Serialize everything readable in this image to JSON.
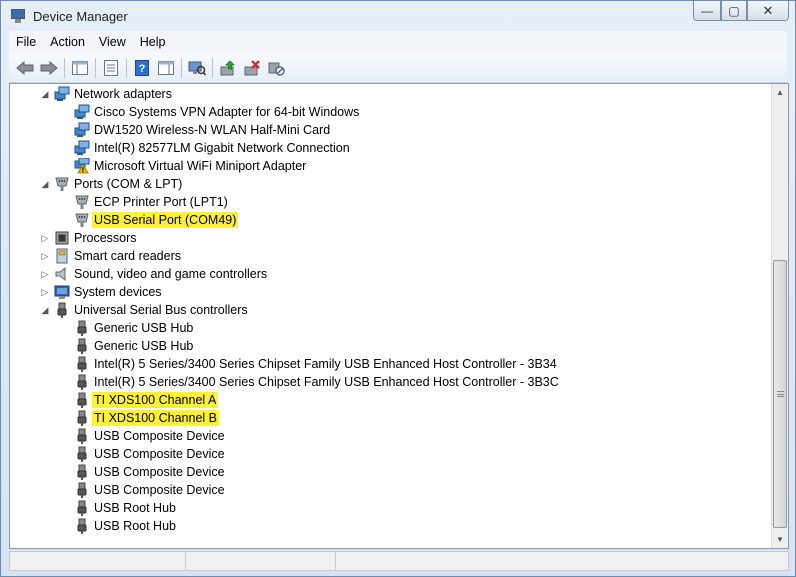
{
  "window": {
    "title": "Device Manager",
    "min_symbol": "—",
    "max_symbol": "▢",
    "close_symbol": "✕"
  },
  "menu": {
    "items": [
      "File",
      "Action",
      "View",
      "Help"
    ]
  },
  "toolbar": {
    "buttons": [
      {
        "name": "back-button",
        "glyph": "⇦"
      },
      {
        "name": "forward-button",
        "glyph": "⇨"
      },
      {
        "name": "show-hide-console-tree-button",
        "glyph": "▤"
      },
      {
        "name": "properties-button",
        "glyph": "▦"
      },
      {
        "name": "help-button",
        "glyph": "?"
      },
      {
        "name": "show-action-pane-button",
        "glyph": "▣"
      },
      {
        "name": "scan-hardware-changes-button",
        "glyph": "⌕"
      },
      {
        "name": "update-driver-button",
        "glyph": "⇪"
      },
      {
        "name": "uninstall-button",
        "glyph": "✖"
      },
      {
        "name": "disable-button",
        "glyph": "⊘"
      }
    ]
  },
  "tree": {
    "rows": [
      {
        "label": "Network adapters",
        "level": 0,
        "expanded": true,
        "icon": "network-adapter-icon",
        "highlight": false
      },
      {
        "label": "Cisco Systems VPN Adapter for 64-bit Windows",
        "level": 1,
        "icon": "network-adapter-icon",
        "highlight": false
      },
      {
        "label": "DW1520 Wireless-N WLAN Half-Mini Card",
        "level": 1,
        "icon": "network-adapter-icon",
        "highlight": false
      },
      {
        "label": "Intel(R) 82577LM Gigabit Network Connection",
        "level": 1,
        "icon": "network-adapter-icon",
        "highlight": false
      },
      {
        "label": "Microsoft Virtual WiFi Miniport Adapter",
        "level": 1,
        "icon": "network-adapter-warning-icon",
        "highlight": false
      },
      {
        "label": "Ports (COM & LPT)",
        "level": 0,
        "expanded": true,
        "icon": "port-icon",
        "highlight": false
      },
      {
        "label": "ECP Printer Port (LPT1)",
        "level": 1,
        "icon": "port-icon",
        "highlight": false
      },
      {
        "label": "USB Serial Port (COM49)",
        "level": 1,
        "icon": "port-icon",
        "highlight": true
      },
      {
        "label": "Processors",
        "level": 0,
        "expanded": false,
        "icon": "processor-icon",
        "highlight": false
      },
      {
        "label": "Smart card readers",
        "level": 0,
        "expanded": false,
        "icon": "smart-card-reader-icon",
        "highlight": false
      },
      {
        "label": "Sound, video and game controllers",
        "level": 0,
        "expanded": false,
        "icon": "speaker-icon",
        "highlight": false
      },
      {
        "label": "System devices",
        "level": 0,
        "expanded": false,
        "icon": "system-device-icon",
        "highlight": false
      },
      {
        "label": "Universal Serial Bus controllers",
        "level": 0,
        "expanded": true,
        "icon": "usb-plug-icon",
        "highlight": false
      },
      {
        "label": "Generic USB Hub",
        "level": 1,
        "icon": "usb-plug-icon",
        "highlight": false
      },
      {
        "label": "Generic USB Hub",
        "level": 1,
        "icon": "usb-plug-icon",
        "highlight": false
      },
      {
        "label": "Intel(R) 5 Series/3400 Series Chipset Family USB Enhanced Host Controller - 3B34",
        "level": 1,
        "icon": "usb-plug-icon",
        "highlight": false
      },
      {
        "label": "Intel(R) 5 Series/3400 Series Chipset Family USB Enhanced Host Controller - 3B3C",
        "level": 1,
        "icon": "usb-plug-icon",
        "highlight": false
      },
      {
        "label": "TI XDS100 Channel A",
        "level": 1,
        "icon": "usb-plug-icon",
        "highlight": true
      },
      {
        "label": "TI XDS100 Channel B",
        "level": 1,
        "icon": "usb-plug-icon",
        "highlight": true
      },
      {
        "label": "USB Composite Device",
        "level": 1,
        "icon": "usb-plug-icon",
        "highlight": false
      },
      {
        "label": "USB Composite Device",
        "level": 1,
        "icon": "usb-plug-icon",
        "highlight": false
      },
      {
        "label": "USB Composite Device",
        "level": 1,
        "icon": "usb-plug-icon",
        "highlight": false
      },
      {
        "label": "USB Composite Device",
        "level": 1,
        "icon": "usb-plug-icon",
        "highlight": false
      },
      {
        "label": "USB Root Hub",
        "level": 1,
        "icon": "usb-plug-icon",
        "highlight": false
      },
      {
        "label": "USB Root Hub",
        "level": 1,
        "icon": "usb-plug-icon",
        "highlight": false
      }
    ]
  },
  "colors": {
    "highlight": "#fff03a",
    "window_frame": "#d5e3f3"
  }
}
